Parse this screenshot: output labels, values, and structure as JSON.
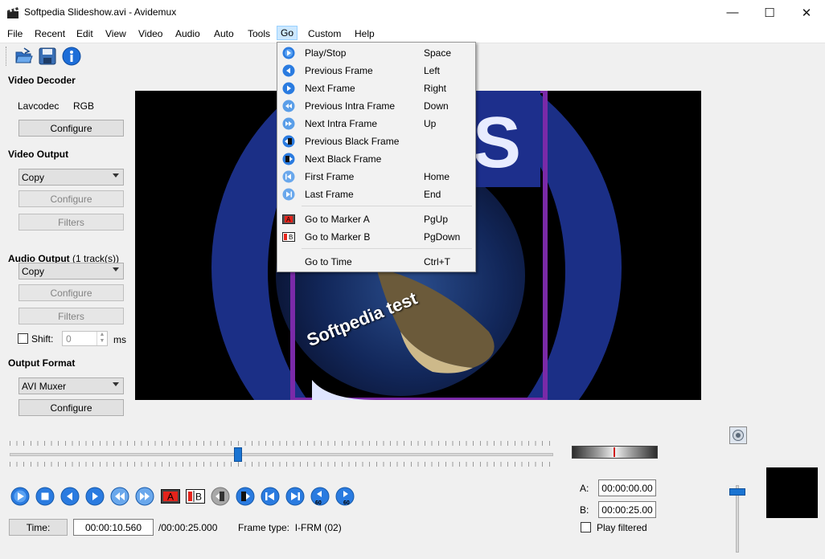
{
  "window": {
    "title": "Softpedia Slideshow.avi - Avidemux",
    "minimize": "—",
    "maximize": "☐",
    "close": "✕"
  },
  "menu": [
    "File",
    "Recent",
    "Edit",
    "View",
    "Video",
    "Audio",
    "Auto",
    "Tools",
    "Go",
    "Custom",
    "Help"
  ],
  "toolbar": {
    "icons": [
      "open-folder-icon",
      "save-disk-icon",
      "info-icon"
    ]
  },
  "left_panel": {
    "video_decoder": {
      "title": "Video Decoder",
      "codec": "Lavcodec",
      "colorspace": "RGB",
      "configure": "Configure"
    },
    "video_output": {
      "title": "Video Output",
      "selected": "Copy",
      "configure": "Configure",
      "filters": "Filters"
    },
    "audio_output": {
      "title": "Audio Output",
      "tracks": "(1 track(s))",
      "selected": "Copy",
      "configure": "Configure",
      "filters": "Filters",
      "shift_label": "Shift:",
      "shift_value": "0",
      "shift_unit": "ms"
    },
    "output_format": {
      "title": "Output Format",
      "selected": "AVI Muxer",
      "configure": "Configure"
    }
  },
  "go_menu": {
    "items": [
      {
        "label": "Play/Stop",
        "shortcut": "Space",
        "icon": "play-icon"
      },
      {
        "label": "Previous Frame",
        "shortcut": "Left",
        "icon": "previous-frame-icon"
      },
      {
        "label": "Next Frame",
        "shortcut": "Right",
        "icon": "next-frame-icon"
      },
      {
        "label": "Previous Intra Frame",
        "shortcut": "Down",
        "icon": "previous-intra-icon"
      },
      {
        "label": "Next Intra Frame",
        "shortcut": "Up",
        "icon": "next-intra-icon"
      },
      {
        "label": "Previous Black Frame",
        "shortcut": "",
        "icon": "previous-black-icon"
      },
      {
        "label": "Next Black Frame",
        "shortcut": "",
        "icon": "next-black-icon"
      },
      {
        "label": "First Frame",
        "shortcut": "Home",
        "icon": "first-frame-icon"
      },
      {
        "label": "Last Frame",
        "shortcut": "End",
        "icon": "last-frame-icon"
      },
      {
        "label": "Go to Marker A",
        "shortcut": "PgUp",
        "icon": "marker-a-icon"
      },
      {
        "label": "Go to Marker B",
        "shortcut": "PgDown",
        "icon": "marker-b-icon"
      },
      {
        "label": "Go to Time",
        "shortcut": "Ctrl+T",
        "icon": ""
      }
    ]
  },
  "video_overlay_text": "Softpedia test",
  "timeline": {
    "position": 0.42
  },
  "status": {
    "time_button": "Time:",
    "current_time": "00:00:10.560",
    "total_time": "/00:00:25.000",
    "frame_type": "Frame type:  I-FRM (02)"
  },
  "markers": {
    "a_label": "A:",
    "a_time": "00:00:00.00",
    "b_label": "B:",
    "b_time": "00:00:25.00",
    "play_filtered": "Play filtered"
  },
  "volume": {
    "level": 0.95
  },
  "colors": {
    "accent": "#1a74d2",
    "menu_highlight": "#cce8ff",
    "marker_red": "#e4231b"
  }
}
